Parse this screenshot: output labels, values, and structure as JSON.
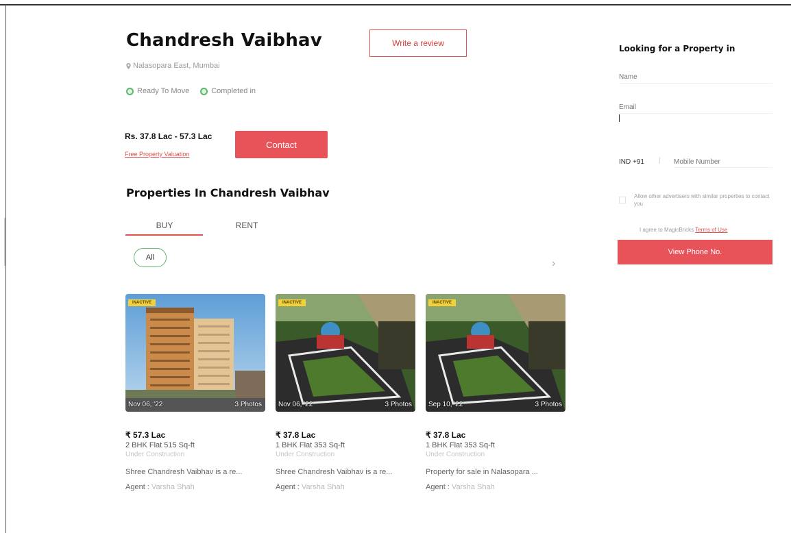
{
  "project": {
    "title": "Chandresh Vaibhav",
    "location": "Nalasopara East, Mumbai",
    "status_ready": "Ready To Move",
    "status_completed": "Completed in",
    "price_range": "Rs. 37.8 Lac - 57.3 Lac",
    "valuation_link": "Free Property Valuation",
    "write_review_label": "Write a review",
    "contact_label": "Contact"
  },
  "properties_section": {
    "title": "Properties In Chandresh Vaibhav",
    "tabs": [
      "BUY",
      "RENT"
    ],
    "active_tab": "BUY",
    "filter_label": "All",
    "next_arrow": "›"
  },
  "listings": [
    {
      "badge": "INACTIVE",
      "date": "Nov 06, '22",
      "photos": "3 Photos",
      "price": "₹ 57.3 Lac",
      "config": "2 BHK Flat 515 Sq-ft",
      "status": "Under Construction",
      "description": "Shree Chandresh Vaibhav is a re...",
      "agent_label": "Agent :",
      "agent_name": "Varsha Shah"
    },
    {
      "badge": "INACTIVE",
      "date": "Nov 06, '22",
      "photos": "3 Photos",
      "price": "₹ 37.8 Lac",
      "config": "1 BHK Flat 353 Sq-ft",
      "status": "Under Construction",
      "description": "Shree Chandresh Vaibhav is a re...",
      "agent_label": "Agent :",
      "agent_name": "Varsha Shah"
    },
    {
      "badge": "INACTIVE",
      "date": "Sep 10, '22",
      "photos": "3 Photos",
      "price": "₹ 37.8 Lac",
      "config": "1 BHK Flat 353 Sq-ft",
      "status": "Under Construction",
      "description": "Property for sale in Nalasopara ...",
      "agent_label": "Agent :",
      "agent_name": "Varsha Shah"
    }
  ],
  "enquiry_form": {
    "title": "Looking for a Property in",
    "name_placeholder": "Name",
    "email_placeholder": "Email",
    "phone_code": "IND +91",
    "phone_placeholder": "Mobile Number",
    "consent_text": "Allow other advertisers with similar properties to contact you",
    "terms_prefix": "I agree to MagicBricks",
    "terms_link": "Terms of Use",
    "view_phone_label": "View Phone No."
  },
  "colors": {
    "accent_red": "#e8535a",
    "status_green": "#59b86b",
    "badge_yellow": "#f3d13a"
  }
}
